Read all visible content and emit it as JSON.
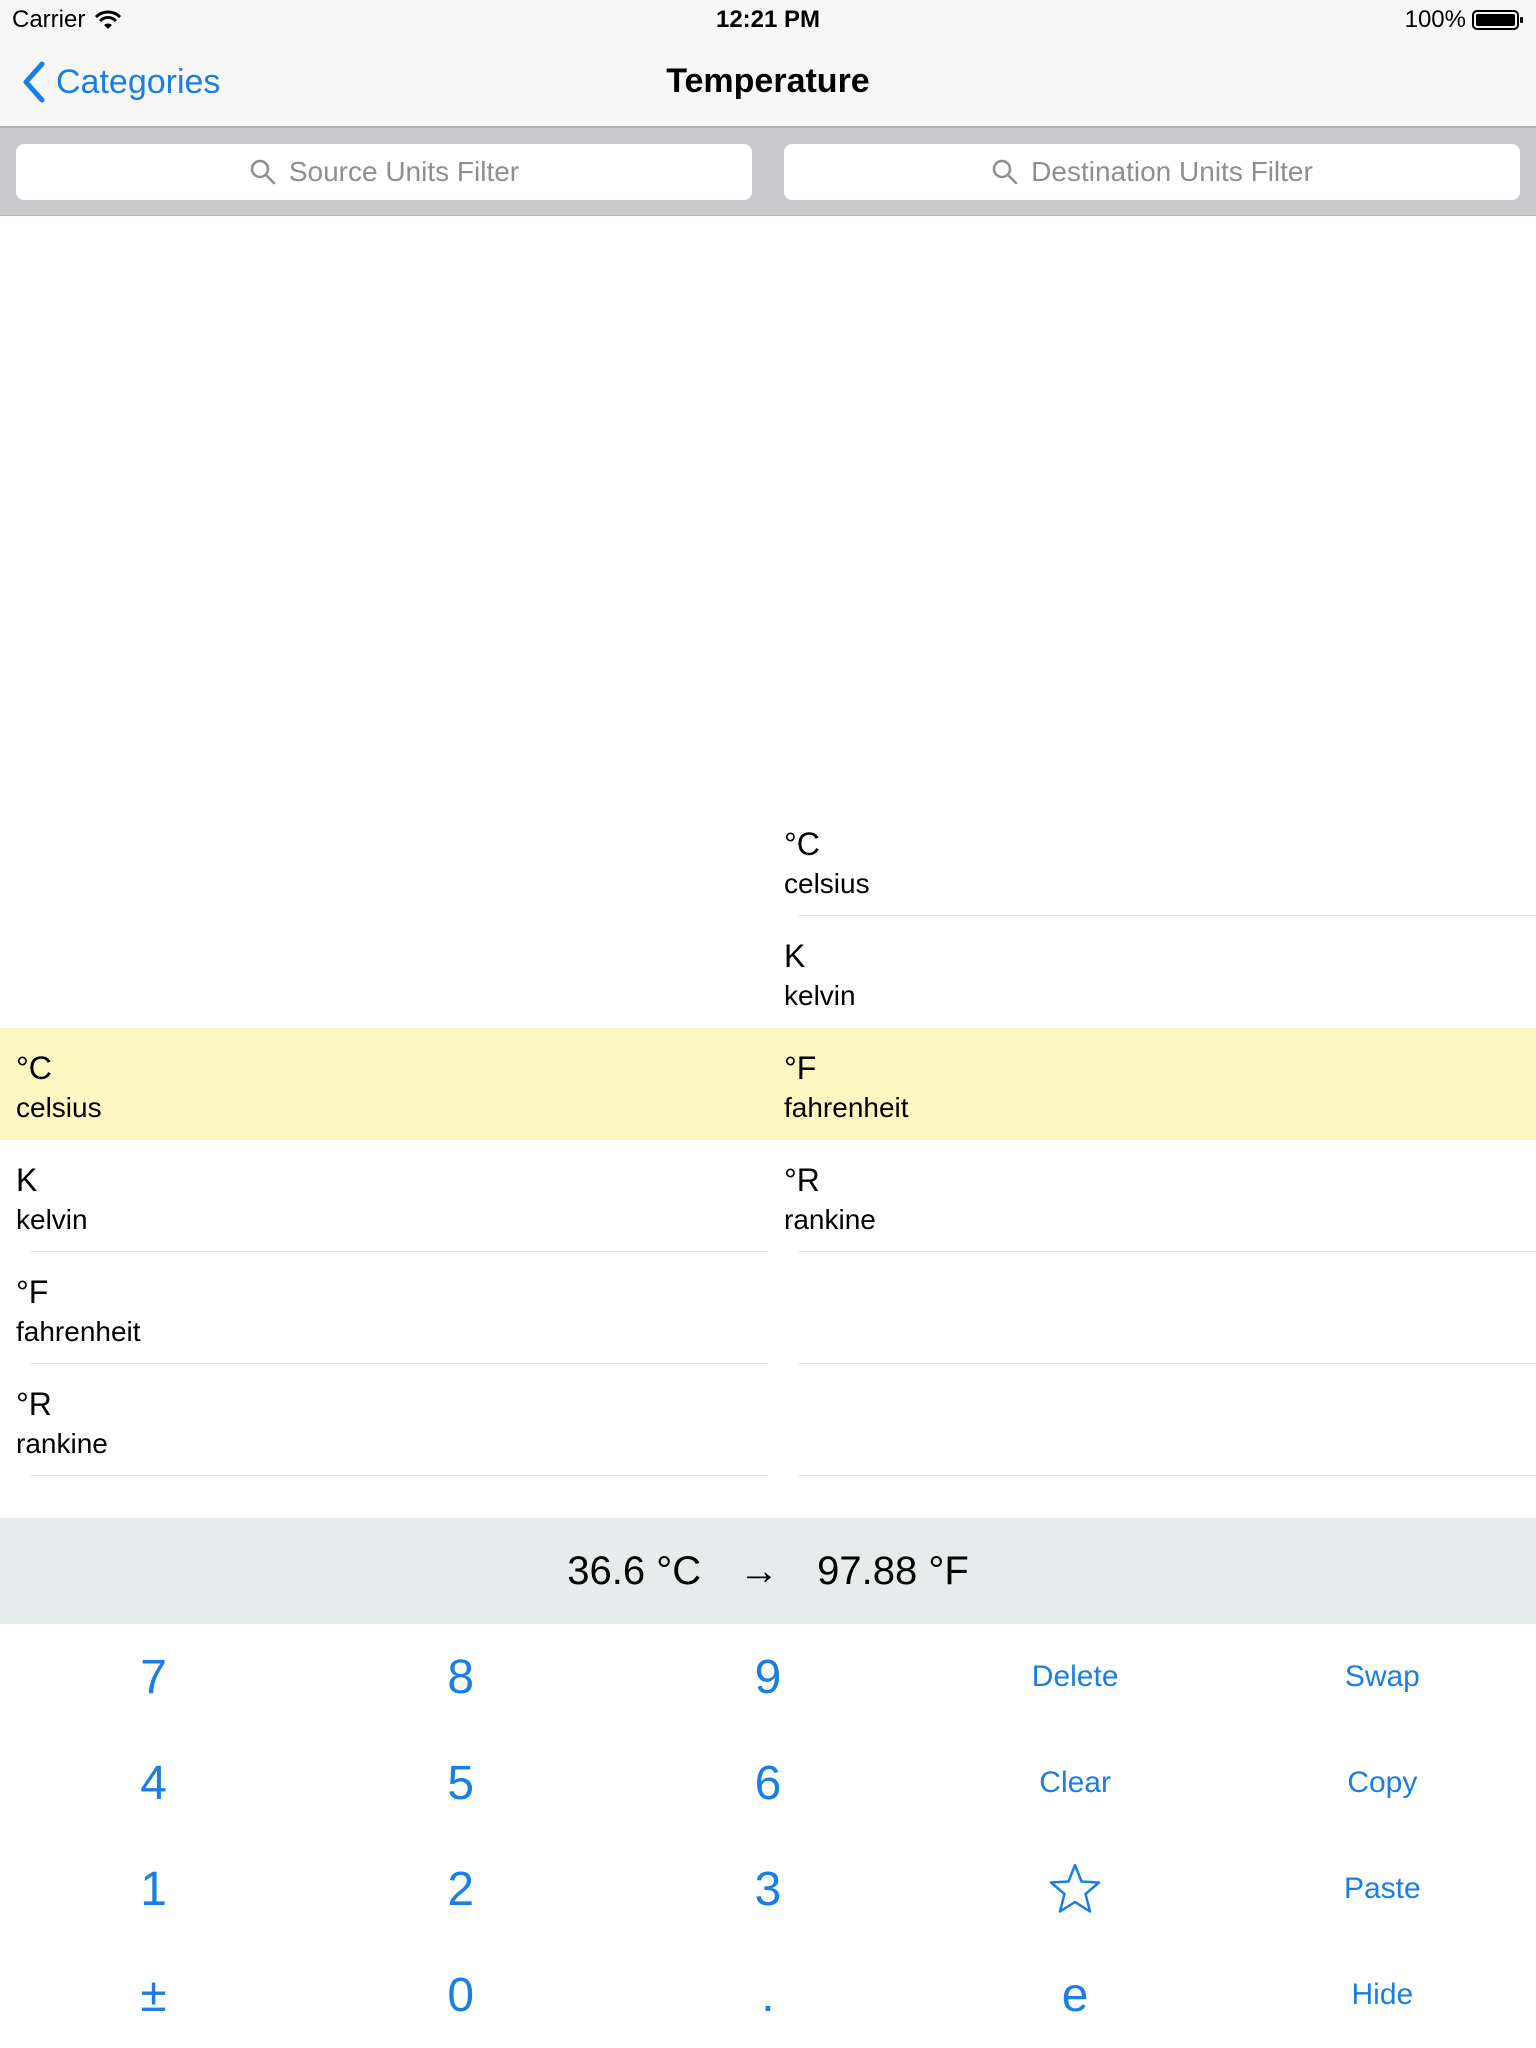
{
  "status_bar": {
    "carrier": "Carrier",
    "time": "12:21 PM",
    "battery": "100%"
  },
  "nav": {
    "back_label": "Categories",
    "title": "Temperature"
  },
  "filters": {
    "source_placeholder": "Source Units Filter",
    "destination_placeholder": "Destination Units Filter"
  },
  "source_units": [
    {
      "symbol": "°C",
      "name": "celsius",
      "selected": true
    },
    {
      "symbol": "K",
      "name": "kelvin",
      "selected": false
    },
    {
      "symbol": "°F",
      "name": "fahrenheit",
      "selected": false
    },
    {
      "symbol": "°R",
      "name": "rankine",
      "selected": false
    }
  ],
  "destination_units": [
    {
      "symbol": "°C",
      "name": "celsius",
      "selected": false
    },
    {
      "symbol": "K",
      "name": "kelvin",
      "selected": false
    },
    {
      "symbol": "°F",
      "name": "fahrenheit",
      "selected": true
    },
    {
      "symbol": "°R",
      "name": "rankine",
      "selected": false
    }
  ],
  "result": {
    "source_value": "36.6 °C",
    "arrow": "→",
    "destination_value": "97.88 °F"
  },
  "keypad": {
    "k7": "7",
    "k8": "8",
    "k9": "9",
    "delete": "Delete",
    "swap": "Swap",
    "k4": "4",
    "k5": "5",
    "k6": "6",
    "clear": "Clear",
    "copy": "Copy",
    "k1": "1",
    "k2": "2",
    "k3": "3",
    "favorite_icon": "star-icon",
    "paste": "Paste",
    "plusminus": "±",
    "k0": "0",
    "dot": ".",
    "e": "e",
    "hide": "Hide"
  },
  "colors": {
    "accent": "#1a7ee3",
    "selected_row": "#fdf7c1",
    "result_bar": "#e6ebeb",
    "filter_bar": "#c9c9ce"
  }
}
